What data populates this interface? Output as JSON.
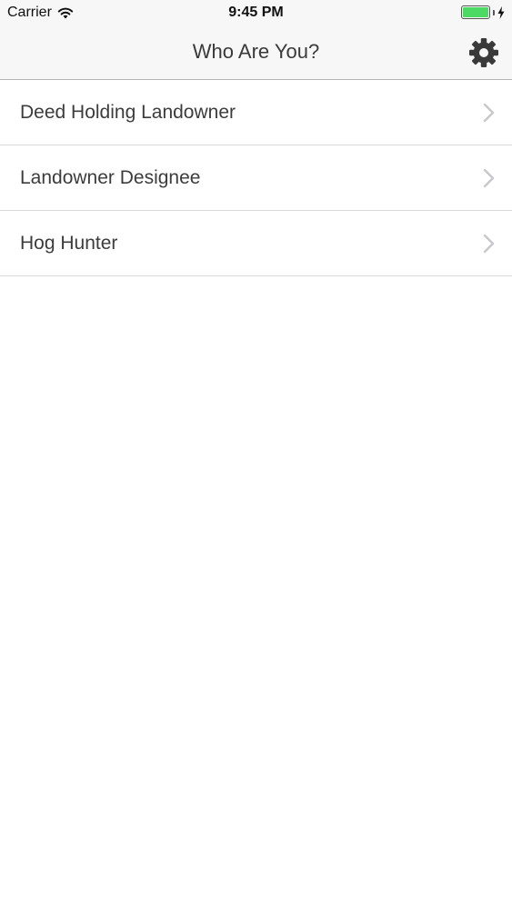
{
  "status_bar": {
    "carrier": "Carrier",
    "time": "9:45 PM",
    "battery_level": 1.0,
    "battery_color": "#4cd964"
  },
  "nav": {
    "title": "Who Are You?",
    "settings_icon": "gear-icon"
  },
  "list": {
    "items": [
      {
        "label": "Deed Holding Landowner"
      },
      {
        "label": "Landowner Designee"
      },
      {
        "label": "Hog Hunter"
      }
    ],
    "accessory_icon": "chevron-right-icon"
  },
  "colors": {
    "bar_background": "#f7f7f7",
    "text": "#3c3c3c",
    "separator": "#d9d9d9",
    "chevron": "#c7c7cc"
  }
}
